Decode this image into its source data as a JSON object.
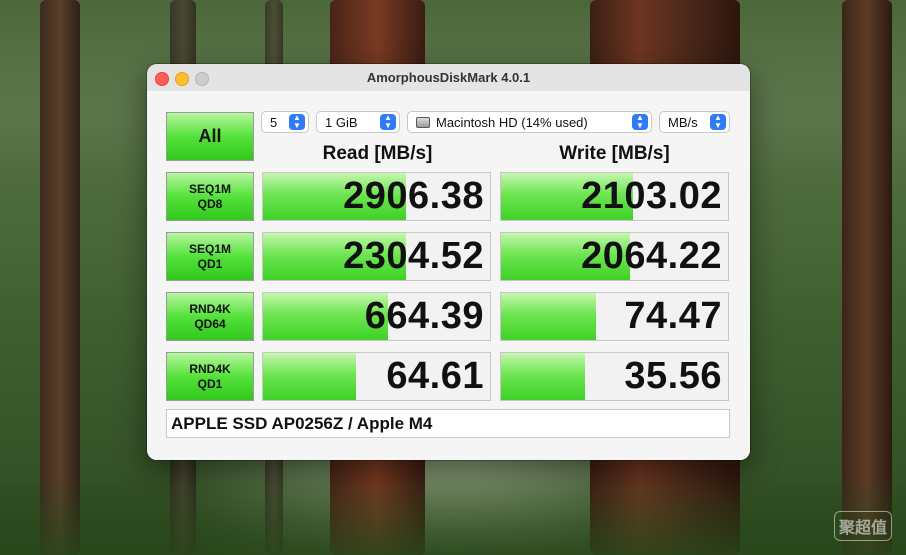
{
  "window": {
    "title": "AmorphousDiskMark 4.0.1"
  },
  "toolbar": {
    "all_button": "All",
    "count": "5",
    "size": "1 GiB",
    "drive": "Macintosh HD (14% used)",
    "unit": "MB/s"
  },
  "headers": {
    "read": "Read [MB/s]",
    "write": "Write [MB/s]"
  },
  "tests": [
    {
      "line1": "SEQ1M",
      "line2": "QD8",
      "read": "2906.38",
      "write": "2103.02",
      "read_fill": 0.63,
      "write_fill": 0.58
    },
    {
      "line1": "SEQ1M",
      "line2": "QD1",
      "read": "2304.52",
      "write": "2064.22",
      "read_fill": 0.63,
      "write_fill": 0.57
    },
    {
      "line1": "RND4K",
      "line2": "QD64",
      "read": "664.39",
      "write": "74.47",
      "read_fill": 0.55,
      "write_fill": 0.42
    },
    {
      "line1": "RND4K",
      "line2": "QD1",
      "read": "64.61",
      "write": "35.56",
      "read_fill": 0.41,
      "write_fill": 0.37
    }
  ],
  "info": {
    "text": "APPLE SSD AP0256Z / Apple M4"
  },
  "watermark": "聚超值",
  "colors": {
    "bar_green": "#3ed126",
    "button_green": "#54e23a",
    "chevron_blue": "#2f7cf6",
    "close_red": "#fe5f57",
    "minimize_yellow": "#febc2e"
  }
}
